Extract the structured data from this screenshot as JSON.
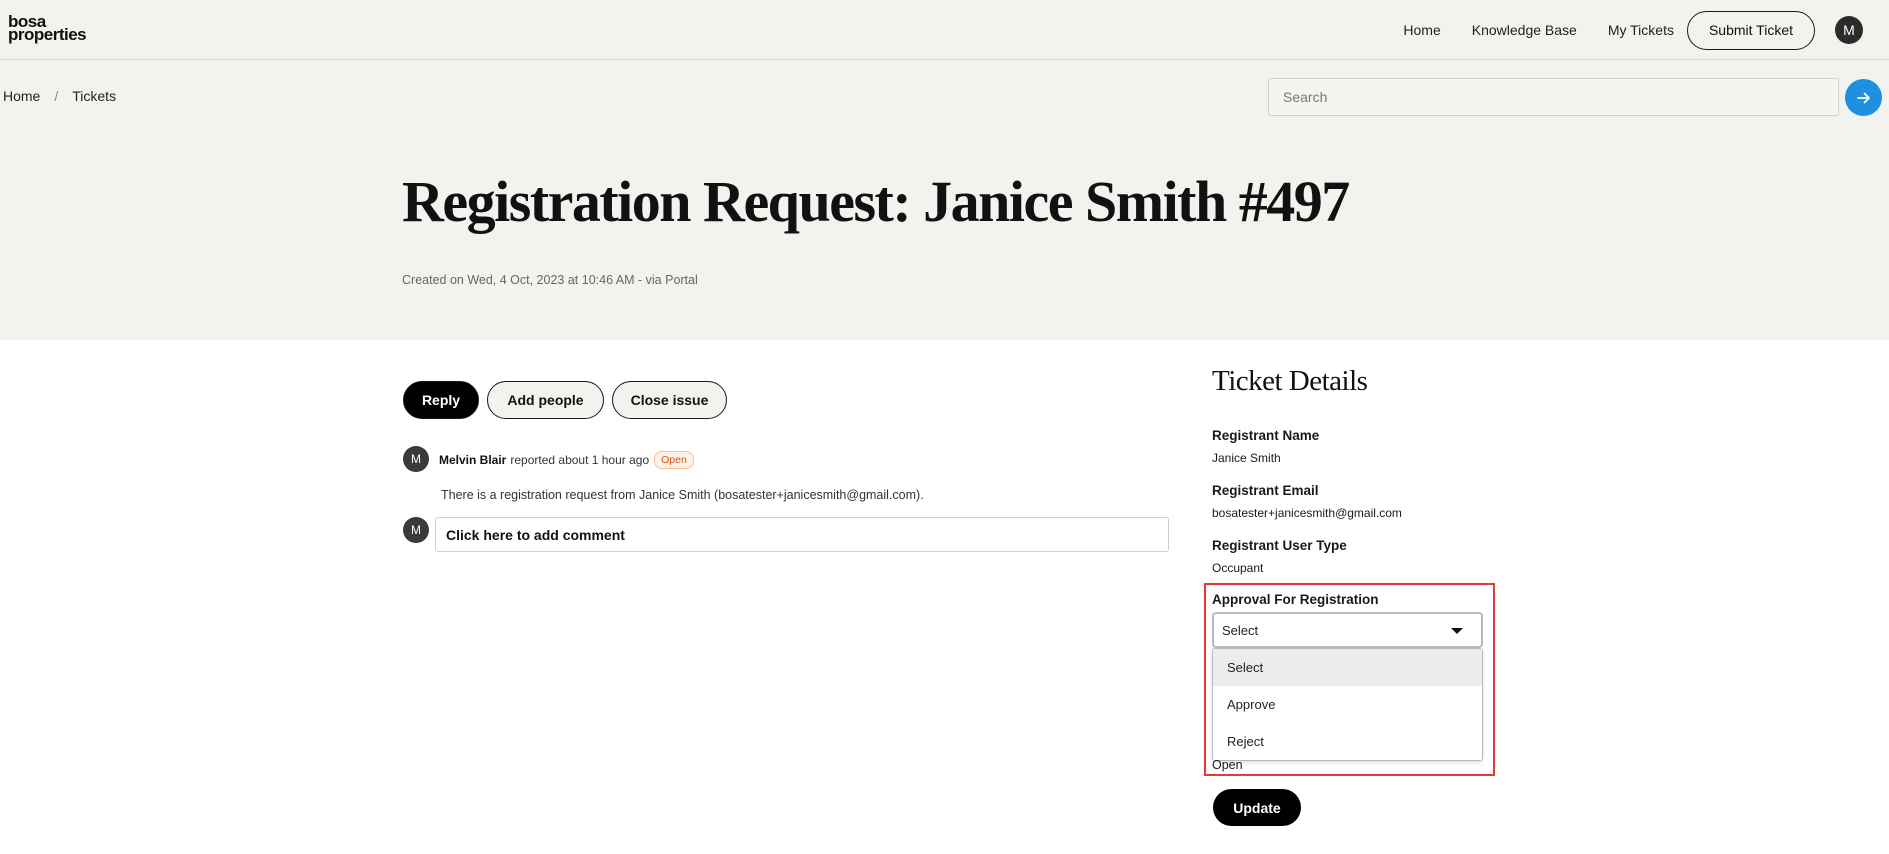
{
  "header": {
    "logo_line1": "bosa",
    "logo_line2": "properties",
    "nav": [
      {
        "label": "Home"
      },
      {
        "label": "Knowledge Base"
      },
      {
        "label": "My Tickets"
      }
    ],
    "submit_label": "Submit Ticket",
    "avatar_initial": "M",
    "avatar_icon": "user-avatar-icon"
  },
  "breadcrumb": {
    "items": [
      {
        "label": "Home"
      },
      {
        "label": "Tickets"
      }
    ],
    "separator": "/"
  },
  "search": {
    "placeholder": "Search",
    "value": "",
    "button_icon": "arrow-right-icon",
    "button_color": "#1f8fe0"
  },
  "ticket": {
    "title": "Registration Request: Janice Smith #497",
    "created": "Created on Wed, 4 Oct, 2023 at 10:46 AM - via Portal"
  },
  "actions": {
    "reply": "Reply",
    "add_people": "Add people",
    "close_issue": "Close issue"
  },
  "activity": {
    "avatar_initial": "M",
    "author": "Melvin Blair",
    "action": "reported about 1 hour ago",
    "status": "Open",
    "status_color": "#d4541a",
    "message": "There is a registration request from Janice Smith (bosatester+janicesmith@gmail.com)."
  },
  "comment": {
    "avatar_initial": "M",
    "placeholder": "Click here to add comment"
  },
  "details": {
    "title": "Ticket Details",
    "fields": [
      {
        "label": "Registrant Name",
        "value": "Janice Smith"
      },
      {
        "label": "Registrant Email",
        "value": "bosatester+janicesmith@gmail.com"
      },
      {
        "label": "Registrant User Type",
        "value": "Occupant"
      }
    ],
    "approval": {
      "label": "Approval For Registration",
      "selected": "Select",
      "options": [
        {
          "label": "Select"
        },
        {
          "label": "Approve"
        },
        {
          "label": "Reject"
        }
      ],
      "highlight_color": "#e53935"
    },
    "status_value": "Open",
    "update_label": "Update"
  }
}
